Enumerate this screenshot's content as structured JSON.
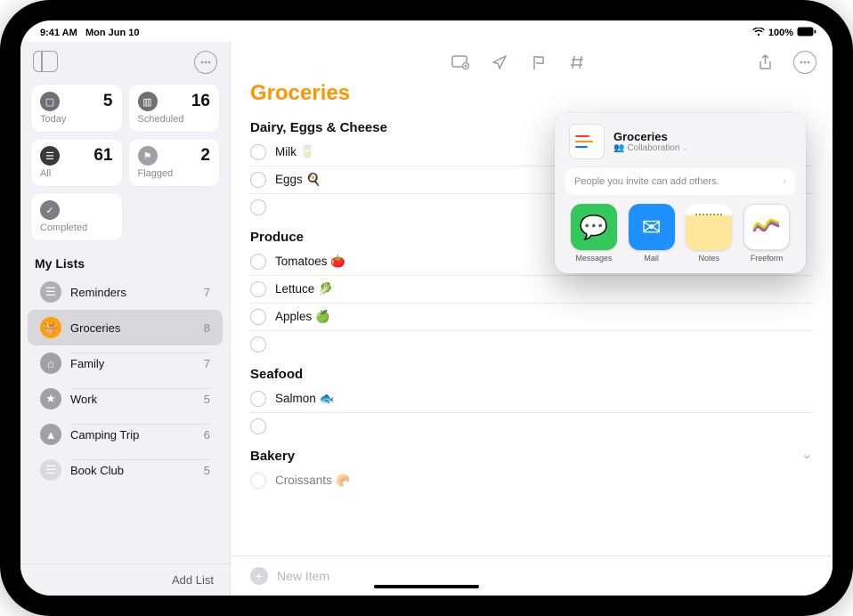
{
  "status": {
    "time": "9:41 AM",
    "date": "Mon Jun 10",
    "battery": "100%"
  },
  "sidebar": {
    "smart": [
      {
        "label": "Today",
        "count": 5
      },
      {
        "label": "Scheduled",
        "count": 16
      },
      {
        "label": "All",
        "count": 61
      },
      {
        "label": "Flagged",
        "count": 2
      },
      {
        "label": "Completed",
        "count": ""
      }
    ],
    "section": "My Lists",
    "lists": [
      {
        "name": "Reminders",
        "count": 7
      },
      {
        "name": "Groceries",
        "count": 8
      },
      {
        "name": "Family",
        "count": 7
      },
      {
        "name": "Work",
        "count": 5
      },
      {
        "name": "Camping Trip",
        "count": 6
      },
      {
        "name": "Book Club",
        "count": 5
      }
    ],
    "add_list": "Add List"
  },
  "main": {
    "title": "Groceries",
    "new_item": "New Item",
    "groups": [
      {
        "title": "Dairy, Eggs & Cheese",
        "items": [
          "Milk 🥛",
          "Eggs 🍳"
        ]
      },
      {
        "title": "Produce",
        "items": [
          "Tomatoes 🍅",
          "Lettuce 🥬",
          "Apples 🍏"
        ]
      },
      {
        "title": "Seafood",
        "items": [
          "Salmon 🐟"
        ]
      },
      {
        "title": "Bakery",
        "items": [
          "Croissants 🥐"
        ]
      }
    ]
  },
  "share": {
    "title": "Groceries",
    "subtitle": "Collaboration",
    "invite": "People you invite can add others.",
    "apps": [
      {
        "name": "Messages"
      },
      {
        "name": "Mail"
      },
      {
        "name": "Notes"
      },
      {
        "name": "Freeform"
      }
    ]
  }
}
